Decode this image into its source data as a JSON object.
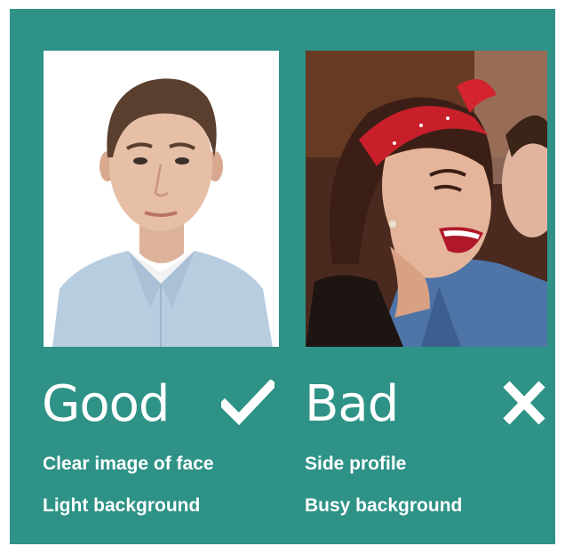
{
  "colors": {
    "panel": "#2e9286",
    "text": "#ffffff"
  },
  "good": {
    "photo_icon": "portrait-photo-good",
    "verdict": "Good",
    "mark_icon": "checkmark-icon",
    "criteria": [
      "Clear image of face",
      "Light background"
    ]
  },
  "bad": {
    "photo_icon": "portrait-photo-bad",
    "verdict": "Bad",
    "mark_icon": "cross-icon",
    "criteria": [
      "Side profile",
      "Busy background"
    ]
  }
}
